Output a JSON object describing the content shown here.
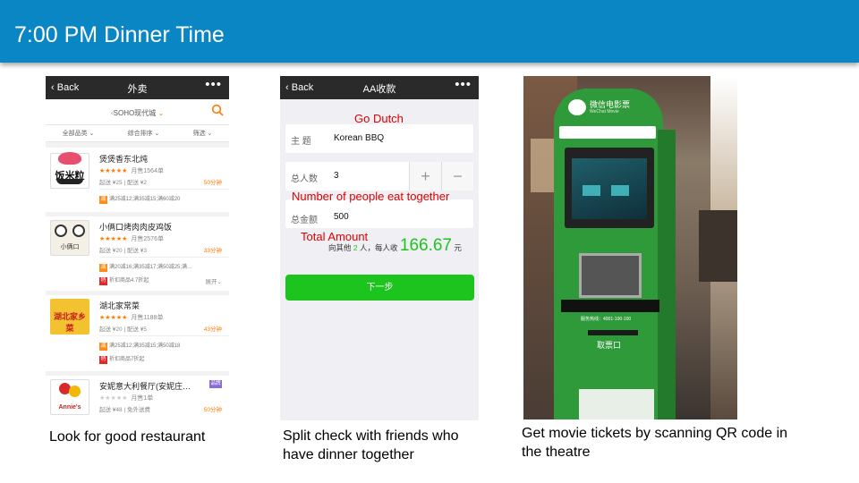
{
  "slide": {
    "title": "7:00 PM Dinner Time"
  },
  "captions": {
    "left": "Look for good restaurant",
    "middle_line1": "Split check with friends who",
    "middle_line2": "have dinner together",
    "right_line1": "Get movie tickets by scanning QR code in",
    "right_line2": "the theatre"
  },
  "phone1": {
    "back": "Back",
    "title": "外卖",
    "more": "•••",
    "location": "SOHO现代城",
    "filters": [
      "全部品类",
      "综合排序",
      "筛选"
    ],
    "restaurants": [
      {
        "name": "煲煲香东北炖",
        "logo_text": "饭米粒",
        "stars": "★★★★★",
        "sales": "月售1564单",
        "info": "起送 ¥25 | 配送 ¥2",
        "time": "50分钟",
        "promos": [
          {
            "tag": "减",
            "text": "满25减12;满35减15;满60减20",
            "color": "#ff8c1a"
          }
        ]
      },
      {
        "name": "小俩口烤肉肉皮鸡饭",
        "logo_text": "小俩口",
        "stars": "★★★★★",
        "sales": "月售2576单",
        "info": "起送 ¥20 | 配送 ¥3",
        "time": "33分钟",
        "promos": [
          {
            "tag": "减",
            "text": "满20减16;满35减17;满50减25;满…",
            "color": "#ff8c1a"
          },
          {
            "tag": "特",
            "text": "折扣商品4.7折起",
            "color": "#e02828"
          }
        ],
        "expand": "展开"
      },
      {
        "name": "湖北家常菜",
        "logo_text": "湖北家乡菜",
        "stars": "★★★★★",
        "sales": "月售1188单",
        "info": "起送 ¥20 | 配送 ¥5",
        "time": "43分钟",
        "promos": [
          {
            "tag": "减",
            "text": "满25减12;满35减15;满50减18",
            "color": "#ff8c1a"
          },
          {
            "tag": "特",
            "text": "折扣商品7折起",
            "color": "#e02828"
          }
        ]
      },
      {
        "name": "安妮意大利餐厅(安妮庄…",
        "logo_text": "Annie's",
        "stars": "★★★★★",
        "sales": "月售1单",
        "info": "起送 ¥48 | 免外送费",
        "time": "50分钟",
        "badge": "品牌"
      }
    ]
  },
  "phone2": {
    "back": "Back",
    "title": "AA收款",
    "more": "•••",
    "subject_label": "主 题",
    "subject_value": "Korean BBQ",
    "count_label": "总人数",
    "count_value": "3",
    "amount_label": "总金额",
    "amount_value": "500",
    "summary_prefix": "向其他",
    "summary_people": "2",
    "summary_mid": "人，每人收",
    "summary_amount": "166.67",
    "summary_unit": "元",
    "next_button": "下一步",
    "annotations": {
      "go_dutch": "Go Dutch",
      "people": "Number of people eat together",
      "total": "Total Amount"
    }
  },
  "kiosk": {
    "brand": "微信电影票",
    "brand_en": "WeChat Movie",
    "hotline": "服务热线：4001-100-100",
    "slot_label": "取票口"
  },
  "colors": {
    "title_bar": "#0a86c5",
    "annotation_red": "#e00000",
    "wechat_green": "#1dc41d",
    "kiosk_green": "#2f9a3a"
  }
}
